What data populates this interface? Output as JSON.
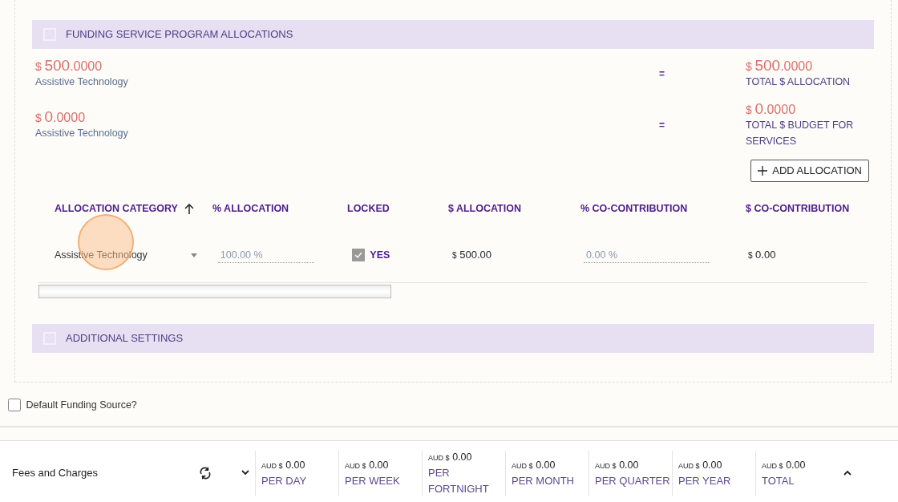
{
  "allocation_panel": {
    "title": "FUNDING SERVICE PROGRAM ALLOCATIONS",
    "expanded": true
  },
  "summary_rows": [
    {
      "amount": {
        "symbol": "$",
        "whole": "500",
        "fraction": ".0000"
      },
      "label": "Assistive Technology",
      "operator": "=",
      "total_amount": {
        "symbol": "$",
        "whole": "500",
        "fraction": ".0000"
      },
      "total_label": "TOTAL $ ALLOCATION"
    },
    {
      "amount": {
        "symbol": "$",
        "whole": "0",
        "fraction": ".0000"
      },
      "label": "Assistive Technology",
      "operator": "=",
      "total_amount": {
        "symbol": "$",
        "whole": "0",
        "fraction": ".0000"
      },
      "total_label": "TOTAL $ BUDGET FOR SERVICES"
    }
  ],
  "add_button": {
    "label": "ADD ALLOCATION"
  },
  "table": {
    "columns": [
      {
        "label": "ALLOCATION CATEGORY",
        "sorted": true
      },
      {
        "label": "% ALLOCATION",
        "sorted": false
      },
      {
        "label": "LOCKED",
        "sorted": false
      },
      {
        "label": "$ ALLOCATION",
        "sorted": false
      },
      {
        "label": "% CO-CONTRIBUTION",
        "sorted": false
      },
      {
        "label": "$ CO-CONTRIBUTION",
        "sorted": false
      }
    ],
    "rows": [
      {
        "category": "Assistive Technology",
        "percent_allocation": "100.00 %",
        "locked": true,
        "locked_label": "YES",
        "dollar_allocation": {
          "symbol": "$",
          "value": "500.00"
        },
        "percent_co_contribution": "0.00 %",
        "dollar_co_contribution": {
          "symbol": "$",
          "value": "0.00"
        }
      }
    ]
  },
  "additional_settings": {
    "title": "ADDITIONAL SETTINGS",
    "expanded": false
  },
  "default_funding_source": {
    "label": "Default Funding Source?",
    "checked": false
  },
  "fees": {
    "title": "Fees and Charges",
    "periods": [
      {
        "currency": "AUD $",
        "value": "0.00",
        "label": "PER DAY"
      },
      {
        "currency": "AUD $",
        "value": "0.00",
        "label": "PER WEEK"
      },
      {
        "currency": "AUD $",
        "value": "0.00",
        "label": "PER FORTNIGHT"
      },
      {
        "currency": "AUD $",
        "value": "0.00",
        "label": "PER MONTH"
      },
      {
        "currency": "AUD $",
        "value": "0.00",
        "label": "PER QUARTER"
      },
      {
        "currency": "AUD $",
        "value": "0.00",
        "label": "PER YEAR"
      },
      {
        "currency": "AUD $",
        "value": "0.00",
        "label": "TOTAL"
      }
    ]
  }
}
